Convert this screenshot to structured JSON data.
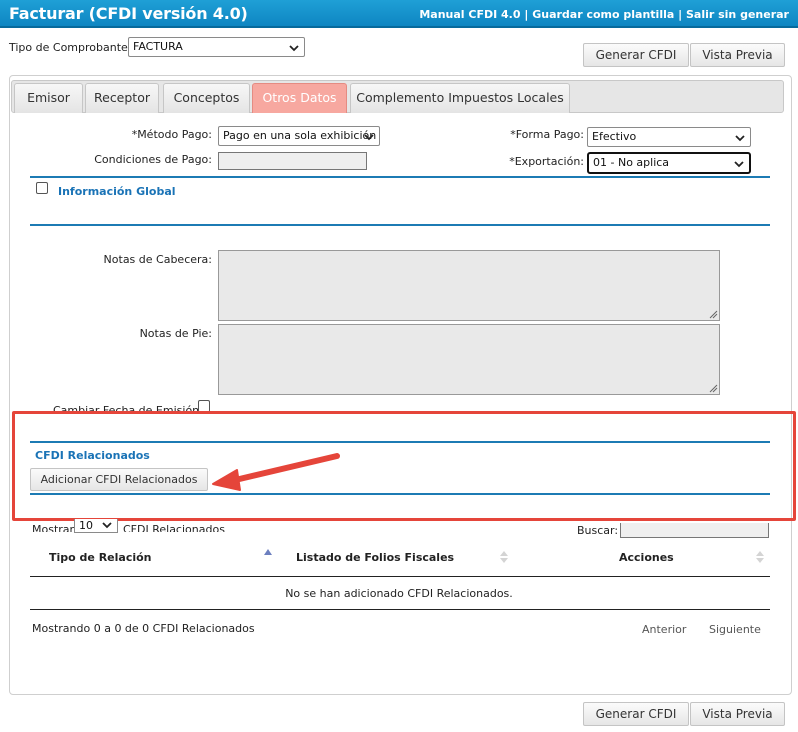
{
  "titlebar": {
    "title": "Facturar (CFDI versión 4.0)",
    "links": [
      "Manual CFDI 4.0",
      "Guardar como plantilla",
      "Salir sin generar"
    ],
    "separator": " | "
  },
  "comprobante": {
    "label": "Tipo de Comprobante:",
    "value": "FACTURA"
  },
  "actions": {
    "generar": "Generar CFDI",
    "vista_previa": "Vista Previa"
  },
  "tabs": [
    "Emisor",
    "Receptor",
    "Conceptos",
    "Otros Datos",
    "Complemento Impuestos Locales"
  ],
  "active_tab": "Otros Datos",
  "form": {
    "metodo_pago_label": "*Método Pago:",
    "metodo_pago_value": "Pago en una sola exhibición",
    "forma_pago_label": "*Forma Pago:",
    "forma_pago_value": "Efectivo",
    "condiciones_label": "Condiciones de Pago:",
    "condiciones_value": "",
    "exportacion_label": "*Exportación:",
    "exportacion_value": "01 - No aplica",
    "informacion_global": "Información Global",
    "notas_cabecera_label": "Notas de Cabecera:",
    "notas_pie_label": "Notas de Pie:",
    "cambiar_fecha_label": "Cambiar Fecha de Emisión:"
  },
  "cfdi_relacionados": {
    "title": "CFDI Relacionados",
    "add_button": "Adicionar CFDI Relacionados",
    "mostrar_label": "Mostrar",
    "page_size": "10",
    "mostrar_suffix": "CFDI Relacionados",
    "buscar_label": "Buscar:",
    "columns": [
      "Tipo de Relación",
      "Listado de Folios Fiscales",
      "Acciones"
    ],
    "empty_message": "No se han adicionado CFDI Relacionados.",
    "info": "Mostrando 0 a 0 de 0 CFDI Relacionados",
    "prev": "Anterior",
    "next": "Siguiente"
  },
  "colors": {
    "titlebar": "#1593cc",
    "active_tab": "#f7a8a0",
    "section_blue": "#1c7bb4",
    "highlight_red": "#e5453a"
  },
  "icons": [
    "chevron-down-icon",
    "sort-asc-icon",
    "sort-both-icon",
    "arrow-annotation-icon",
    "resize-grip-icon"
  ]
}
